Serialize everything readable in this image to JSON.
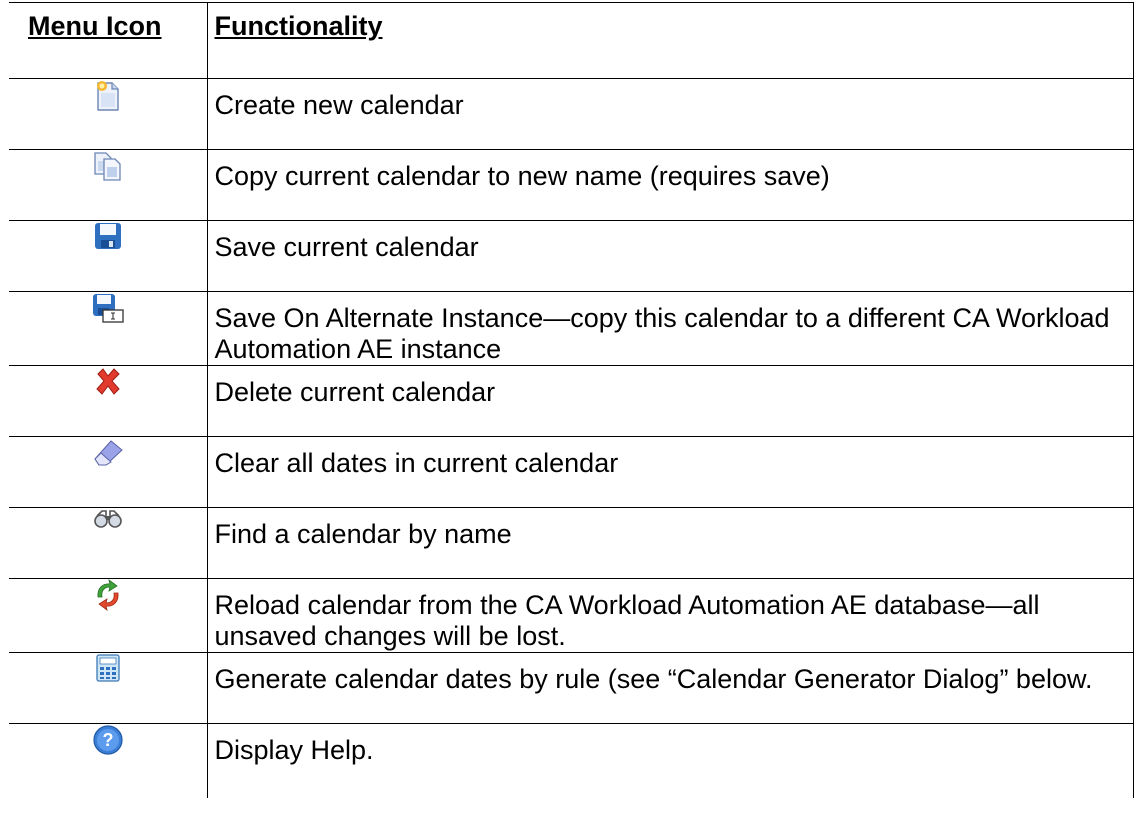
{
  "headers": {
    "icon": "Menu Icon",
    "functionality": "Functionality"
  },
  "rows": [
    {
      "icon": "new-calendar-icon",
      "text": "Create new calendar"
    },
    {
      "icon": "copy-calendar-icon",
      "text": "Copy current calendar to new name (requires save)"
    },
    {
      "icon": "save-icon",
      "text": "Save current calendar"
    },
    {
      "icon": "save-alternate-instance-icon",
      "text": "Save On Alternate Instance—copy this calendar to a different CA Workload Automation AE instance"
    },
    {
      "icon": "delete-icon",
      "text": "Delete current calendar"
    },
    {
      "icon": "eraser-icon",
      "text": "Clear all dates in current calendar"
    },
    {
      "icon": "binoculars-icon",
      "text": "Find a calendar by name"
    },
    {
      "icon": "reload-icon",
      "text": "Reload calendar from the CA Workload Automation AE database—all unsaved changes will be lost."
    },
    {
      "icon": "calculator-icon",
      "text": "Generate calendar dates by rule (see “Calendar Generator Dialog” below."
    },
    {
      "icon": "help-icon",
      "text": "Display Help."
    }
  ]
}
